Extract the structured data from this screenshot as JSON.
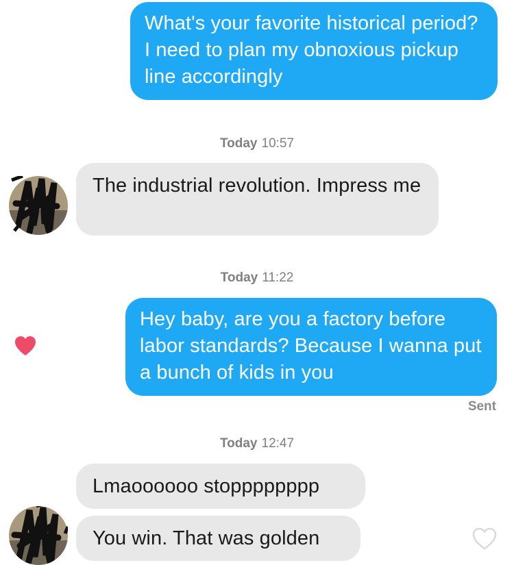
{
  "messages": [
    {
      "direction": "sent",
      "text": "What's your favorite historical period? I need to plan my obnoxious pickup line accordingly"
    },
    {
      "direction": "received",
      "text": "The industrial revolution. Impress me"
    },
    {
      "direction": "sent",
      "text": "Hey baby, are you a factory before labor standards? Because I wanna put a bunch of kids in you"
    },
    {
      "direction": "received",
      "text": "Lmaoooooo stopppppppp"
    },
    {
      "direction": "received",
      "text": "You win. That was golden"
    }
  ],
  "timestamps": [
    {
      "day": "Today",
      "time": "10:57"
    },
    {
      "day": "Today",
      "time": "11:22"
    },
    {
      "day": "Today",
      "time": "12:47"
    }
  ],
  "status": {
    "sent_label": "Sent"
  },
  "icons": {
    "liked": "heart-filled-icon",
    "like": "heart-outline-icon",
    "avatar": "avatar-scribbled"
  },
  "colors": {
    "sent_bubble": "#1fa8f3",
    "received_bubble": "#e8e8e8",
    "heart": "#ee4b6a"
  }
}
